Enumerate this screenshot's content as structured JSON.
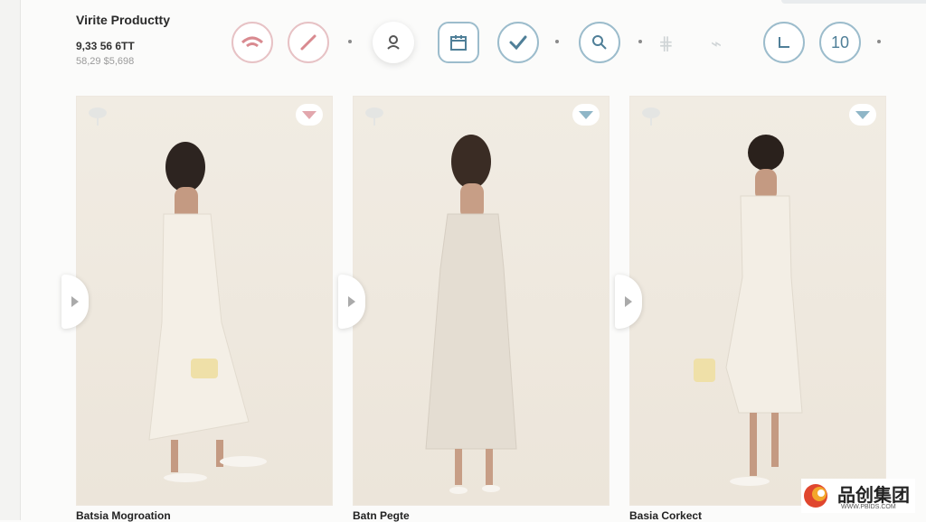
{
  "header": {
    "title": "Virite Productty",
    "price": "9,33 56 6TT",
    "subprice": "58,29 $5,698"
  },
  "toolbar": {
    "counter": "10"
  },
  "products": [
    {
      "caption": "Batsia Mogroation"
    },
    {
      "caption": "Batn Pegte"
    },
    {
      "caption": "Basia Corkect"
    }
  ],
  "watermark": {
    "text": "品创集团",
    "sub": "WWW.PBIDS.COM"
  },
  "colors": {
    "accent": "#4f7f98",
    "pink": "#d98a90",
    "card_bg": "#efe9df"
  }
}
